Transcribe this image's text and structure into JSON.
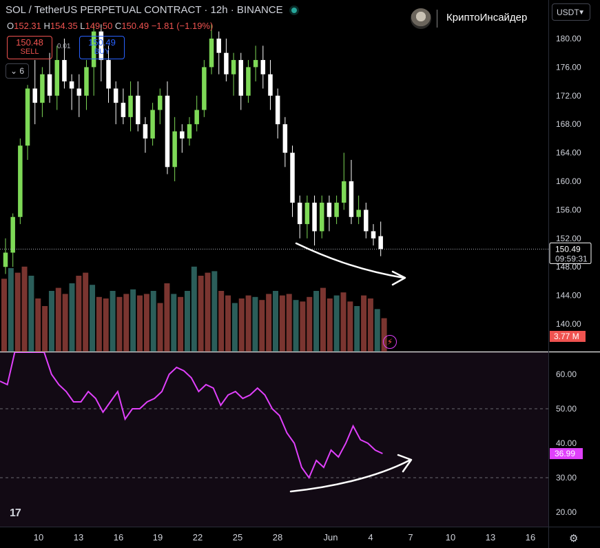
{
  "header": {
    "title": "SOL / TetherUS PERPETUAL CONTRACT · 12h · BINANCE",
    "ohlc": {
      "o_label": "O",
      "o": "152.31",
      "h_label": "H",
      "h": "154.35",
      "l_label": "L",
      "l": "149.50",
      "c_label": "C",
      "c": "150.49",
      "change": "−1.81 (−1.19%)"
    }
  },
  "trade": {
    "sell_price": "150.48",
    "sell_label": "SELL",
    "spread": "0.01",
    "buy_price": "150.49",
    "buy_label": "BUY"
  },
  "indicator_badge": "6",
  "brand": {
    "name": "КриптоИнсайдер"
  },
  "currency": {
    "label": "USDT"
  },
  "price_axis": {
    "labels": [
      "180.00",
      "176.00",
      "172.00",
      "168.00",
      "164.00",
      "160.00",
      "156.00",
      "152.00",
      "148.00",
      "144.00",
      "140.00"
    ],
    "current": "150.49",
    "countdown": "09:59:31",
    "volume_badge": "3.77 M"
  },
  "rsi_axis": {
    "labels": [
      "60.00",
      "50.00",
      "40.00",
      "30.00",
      "20.00"
    ],
    "current": "36.99"
  },
  "time_axis": {
    "labels": [
      "10",
      "13",
      "16",
      "19",
      "22",
      "25",
      "28",
      "Jun",
      "4",
      "7",
      "10",
      "13",
      "16"
    ]
  },
  "colors": {
    "up": "#7ed957",
    "down": "#ffffff",
    "vol_up": "#2b5e5a",
    "vol_down": "#7a3530",
    "rsi": "#e040fb",
    "axis_badge": "#e040fb",
    "vol_badge": "#ef5350"
  },
  "chart_data": [
    {
      "type": "candlestick",
      "title": "SOL / TetherUS PERPETUAL CONTRACT · 12h · BINANCE",
      "ylim": [
        137,
        182
      ],
      "candles": [
        [
          148.0,
          152.0,
          147.0,
          150.0
        ],
        [
          150.0,
          155.5,
          148.0,
          155.0
        ],
        [
          155.0,
          166.0,
          154.0,
          165.0
        ],
        [
          165.0,
          173.5,
          163.0,
          173.0
        ],
        [
          173.0,
          177.0,
          168.0,
          171.0
        ],
        [
          171.0,
          176.0,
          169.0,
          175.0
        ],
        [
          175.0,
          178.0,
          171.0,
          172.0
        ],
        [
          172.0,
          179.0,
          170.0,
          177.0
        ],
        [
          177.0,
          180.0,
          173.0,
          174.0
        ],
        [
          174.0,
          175.0,
          170.0,
          173.0
        ],
        [
          173.0,
          175.0,
          169.0,
          172.0
        ],
        [
          172.0,
          177.0,
          170.0,
          176.0
        ],
        [
          176.0,
          182.0,
          172.0,
          181.0
        ],
        [
          181.0,
          182.0,
          174.0,
          177.0
        ],
        [
          177.0,
          179.0,
          171.0,
          173.0
        ],
        [
          173.0,
          174.0,
          168.0,
          171.0
        ],
        [
          171.0,
          173.0,
          168.0,
          169.0
        ],
        [
          169.0,
          174.0,
          167.0,
          172.0
        ],
        [
          172.0,
          174.0,
          167.0,
          168.0
        ],
        [
          168.0,
          169.0,
          164.0,
          166.0
        ],
        [
          166.0,
          171.0,
          165.0,
          170.0
        ],
        [
          170.0,
          173.0,
          168.0,
          172.0
        ],
        [
          172.0,
          174.0,
          161.0,
          162.0
        ],
        [
          162.0,
          169.0,
          160.0,
          167.0
        ],
        [
          167.0,
          168.0,
          164.0,
          166.0
        ],
        [
          166.0,
          169.0,
          165.0,
          168.0
        ],
        [
          168.0,
          172.0,
          167.0,
          170.0
        ],
        [
          170.0,
          177.0,
          169.0,
          176.0
        ],
        [
          176.0,
          182.0,
          175.0,
          180.0
        ],
        [
          180.0,
          181.0,
          175.0,
          178.0
        ],
        [
          178.0,
          180.0,
          174.0,
          175.0
        ],
        [
          175.0,
          178.0,
          172.0,
          177.0
        ],
        [
          177.0,
          178.0,
          170.0,
          172.0
        ],
        [
          172.0,
          177.0,
          171.0,
          176.0
        ],
        [
          176.0,
          179.0,
          174.0,
          177.0
        ],
        [
          177.0,
          179.0,
          173.0,
          175.0
        ],
        [
          175.0,
          177.0,
          170.0,
          172.0
        ],
        [
          172.0,
          173.0,
          166.0,
          168.0
        ],
        [
          168.0,
          169.0,
          162.0,
          164.0
        ],
        [
          164.0,
          165.0,
          155.0,
          157.0
        ],
        [
          157.0,
          158.0,
          152.0,
          154.0
        ],
        [
          154.0,
          158.0,
          152.0,
          157.0
        ],
        [
          157.0,
          158.0,
          151.0,
          153.0
        ],
        [
          153.0,
          158.0,
          152.0,
          157.0
        ],
        [
          157.0,
          158.0,
          153.0,
          155.0
        ],
        [
          155.0,
          158.0,
          154.0,
          157.0
        ],
        [
          157.0,
          164.0,
          156.0,
          160.0
        ],
        [
          160.0,
          163.0,
          154.0,
          155.0
        ],
        [
          155.0,
          158.0,
          154.0,
          156.0
        ],
        [
          156.0,
          157.0,
          152.0,
          153.0
        ],
        [
          153.0,
          154.0,
          151.0,
          152.0
        ],
        [
          152.31,
          154.35,
          149.5,
          150.49
        ]
      ],
      "volumes": [
        48,
        55,
        52,
        56,
        50,
        35,
        30,
        40,
        42,
        38,
        45,
        50,
        52,
        44,
        36,
        35,
        40,
        36,
        38,
        41,
        37,
        38,
        40,
        32,
        45,
        38,
        36,
        40,
        56,
        50,
        52,
        53,
        40,
        37,
        32,
        35,
        37,
        36,
        34,
        38,
        40,
        37,
        38,
        34,
        33,
        36,
        40,
        42,
        35,
        37,
        39,
        33,
        30,
        37,
        35,
        28,
        22
      ]
    },
    {
      "type": "line",
      "title": "RSI",
      "ylim": [
        15,
        68
      ],
      "reference_lines": [
        50,
        30
      ],
      "values": [
        58,
        57,
        75,
        80,
        78,
        74,
        70,
        60,
        57,
        55,
        52,
        52,
        55,
        53,
        49,
        52,
        55,
        47,
        50,
        50,
        52,
        53,
        55,
        60,
        62,
        61,
        59,
        55,
        57,
        56,
        51,
        54,
        55,
        53,
        54,
        56,
        54,
        50,
        48,
        43,
        40,
        33,
        30,
        35,
        33,
        38,
        36,
        40,
        45,
        41,
        40,
        38,
        37
      ]
    }
  ]
}
